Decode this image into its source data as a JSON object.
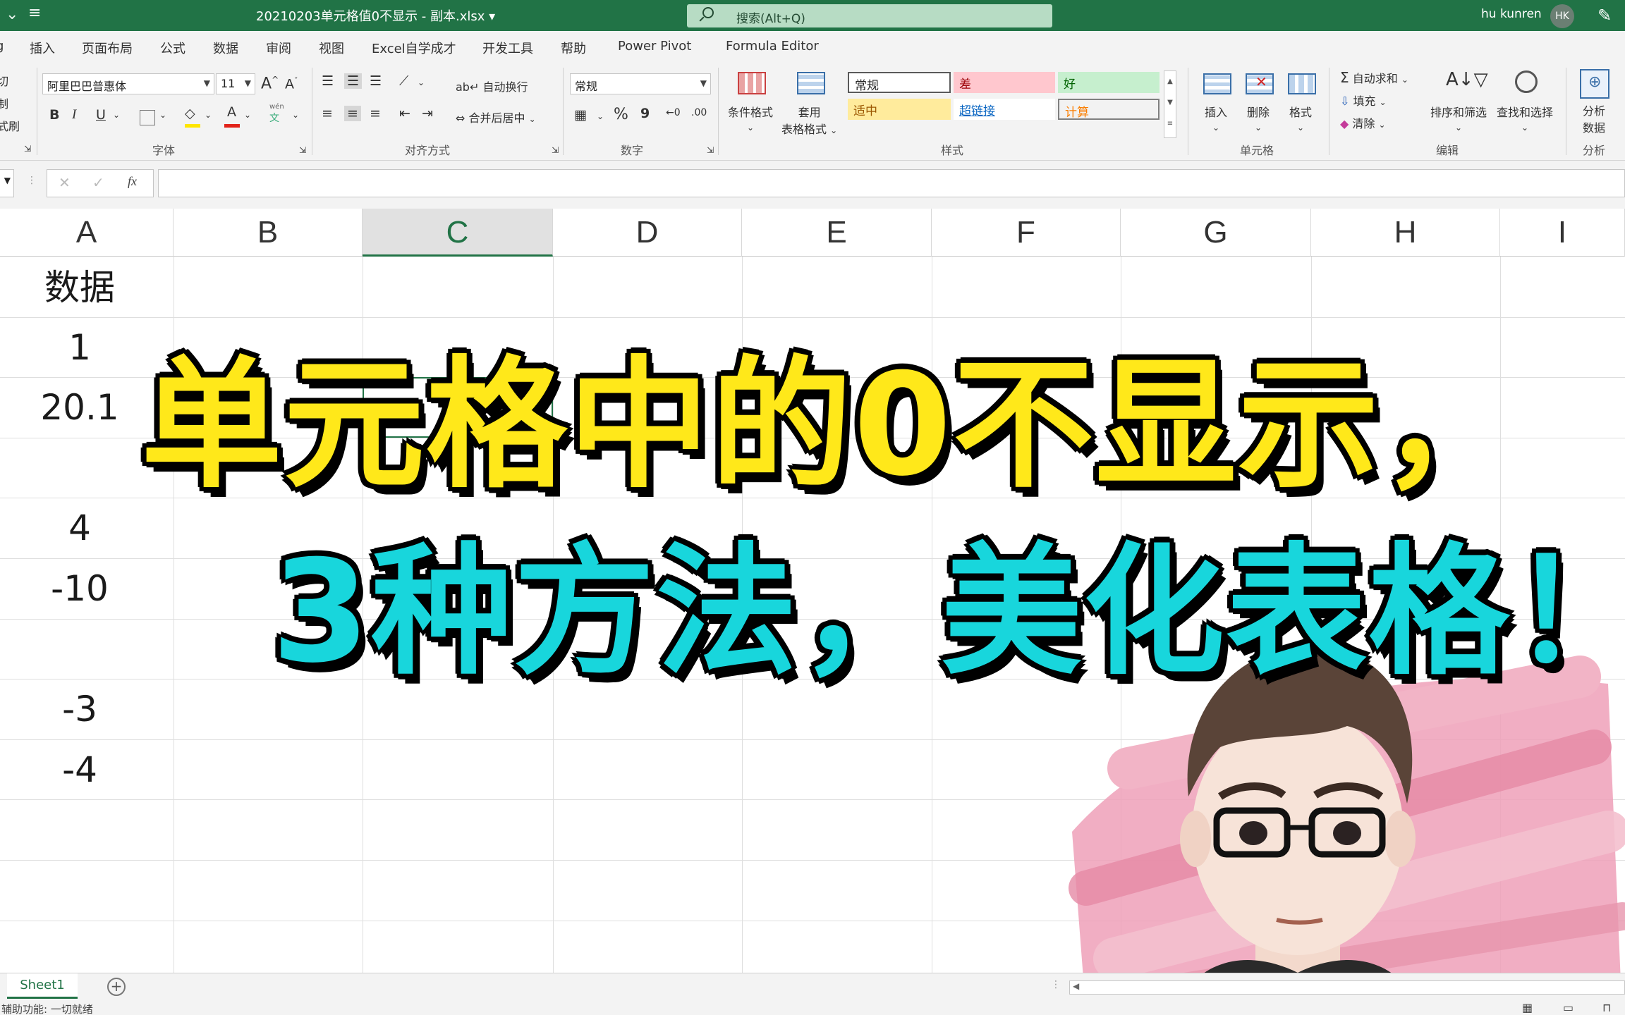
{
  "titlebar": {
    "filename": "20210203单元格值0不显示 - 副本.xlsx",
    "search_placeholder": "搜索(Alt+Q)",
    "user_name": "hu kunren",
    "user_initials": "HK"
  },
  "menu": {
    "items": [
      "插入",
      "页面布局",
      "公式",
      "数据",
      "审阅",
      "视图",
      "Excel自学成才",
      "开发工具",
      "帮助",
      "Power Pivot",
      "Formula Editor"
    ],
    "partial_left": "g"
  },
  "ribbon": {
    "clipboard_partial": [
      "切",
      "制 ",
      "式刷"
    ],
    "font_name": "阿里巴巴普惠体",
    "font_size": "11",
    "grow_font": "A",
    "shrink_font": "A",
    "bold": "B",
    "italic": "I",
    "underline": "U",
    "wen": "wén",
    "wen_char": "文",
    "font_group": "字体",
    "wrap_text": "自动换行",
    "merge_center": "合并后居中",
    "align_group": "对齐方式",
    "number_format": "常规",
    "percent": "%",
    "comma": "9",
    "number_group": "数字",
    "cond_format": "条件格式",
    "table_format_1": "套用",
    "table_format_2": "表格格式",
    "styles": {
      "normal": "常规",
      "bad": "差",
      "good": "好",
      "neutral": "适中",
      "hyperlink": "超链接",
      "calculation": "计算"
    },
    "styles_group": "样式",
    "insert": "插入",
    "delete": "删除",
    "format": "格式",
    "cells_group": "单元格",
    "autosum": "自动求和",
    "fill": "填充",
    "clear": "清除",
    "sort_filter": "排序和筛选",
    "find_select": "查找和选择",
    "edit_group": "编辑",
    "analyze_1": "分析",
    "analyze_2": "数据",
    "analysis_group": "分析"
  },
  "formula_bar": {
    "cancel": "✕",
    "enter": "✓",
    "fx": "fx",
    "content": ""
  },
  "columns": [
    "A",
    "B",
    "C",
    "D",
    "E",
    "F",
    "G",
    "H",
    "I"
  ],
  "selected_column": "C",
  "column_a_values": [
    "数据",
    "1",
    "20.1",
    "",
    "4",
    "-10",
    "",
    "-3",
    "-4",
    "",
    "",
    ""
  ],
  "overlay": {
    "line1": "单元格中的0不显示，",
    "line2": "3种方法，美化表格！"
  },
  "sheets": [
    "Sheet1"
  ],
  "status": "辅助功能: 一切就绪",
  "colors": {
    "excel_green": "#217346",
    "overlay_yellow": "#ffe81a",
    "overlay_cyan": "#18d6dc"
  }
}
